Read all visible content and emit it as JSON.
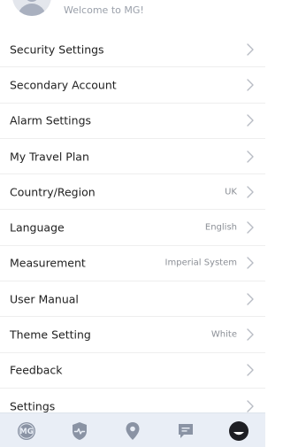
{
  "header": {
    "welcome": "Welcome to MG!"
  },
  "menu": {
    "items": [
      {
        "label": "Security Settings",
        "value": ""
      },
      {
        "label": "Secondary Account",
        "value": ""
      },
      {
        "label": "Alarm Settings",
        "value": ""
      },
      {
        "label": "My Travel Plan",
        "value": ""
      },
      {
        "label": "Country/Region",
        "value": "UK"
      },
      {
        "label": "Language",
        "value": "English"
      },
      {
        "label": "Measurement",
        "value": "Imperial System"
      },
      {
        "label": "User Manual",
        "value": ""
      },
      {
        "label": "Theme Setting",
        "value": "White"
      },
      {
        "label": "Feedback",
        "value": ""
      },
      {
        "label": "Settings",
        "value": ""
      }
    ]
  },
  "tabbar": {
    "tabs": [
      {
        "icon": "mg-logo-icon",
        "text": "MG"
      },
      {
        "icon": "vehicle-health-shield-icon"
      },
      {
        "icon": "location-pin-icon"
      },
      {
        "icon": "message-icon"
      },
      {
        "icon": "profile-face-icon",
        "active": true
      }
    ]
  },
  "colors": {
    "text": "#1f1f1f",
    "secondary_text": "#8b8f96",
    "chevron": "#b8bcc4",
    "tabbar_bg": "#e9eef6",
    "tab_icon": "#8a93a4",
    "tab_active": "#1e1f24"
  }
}
